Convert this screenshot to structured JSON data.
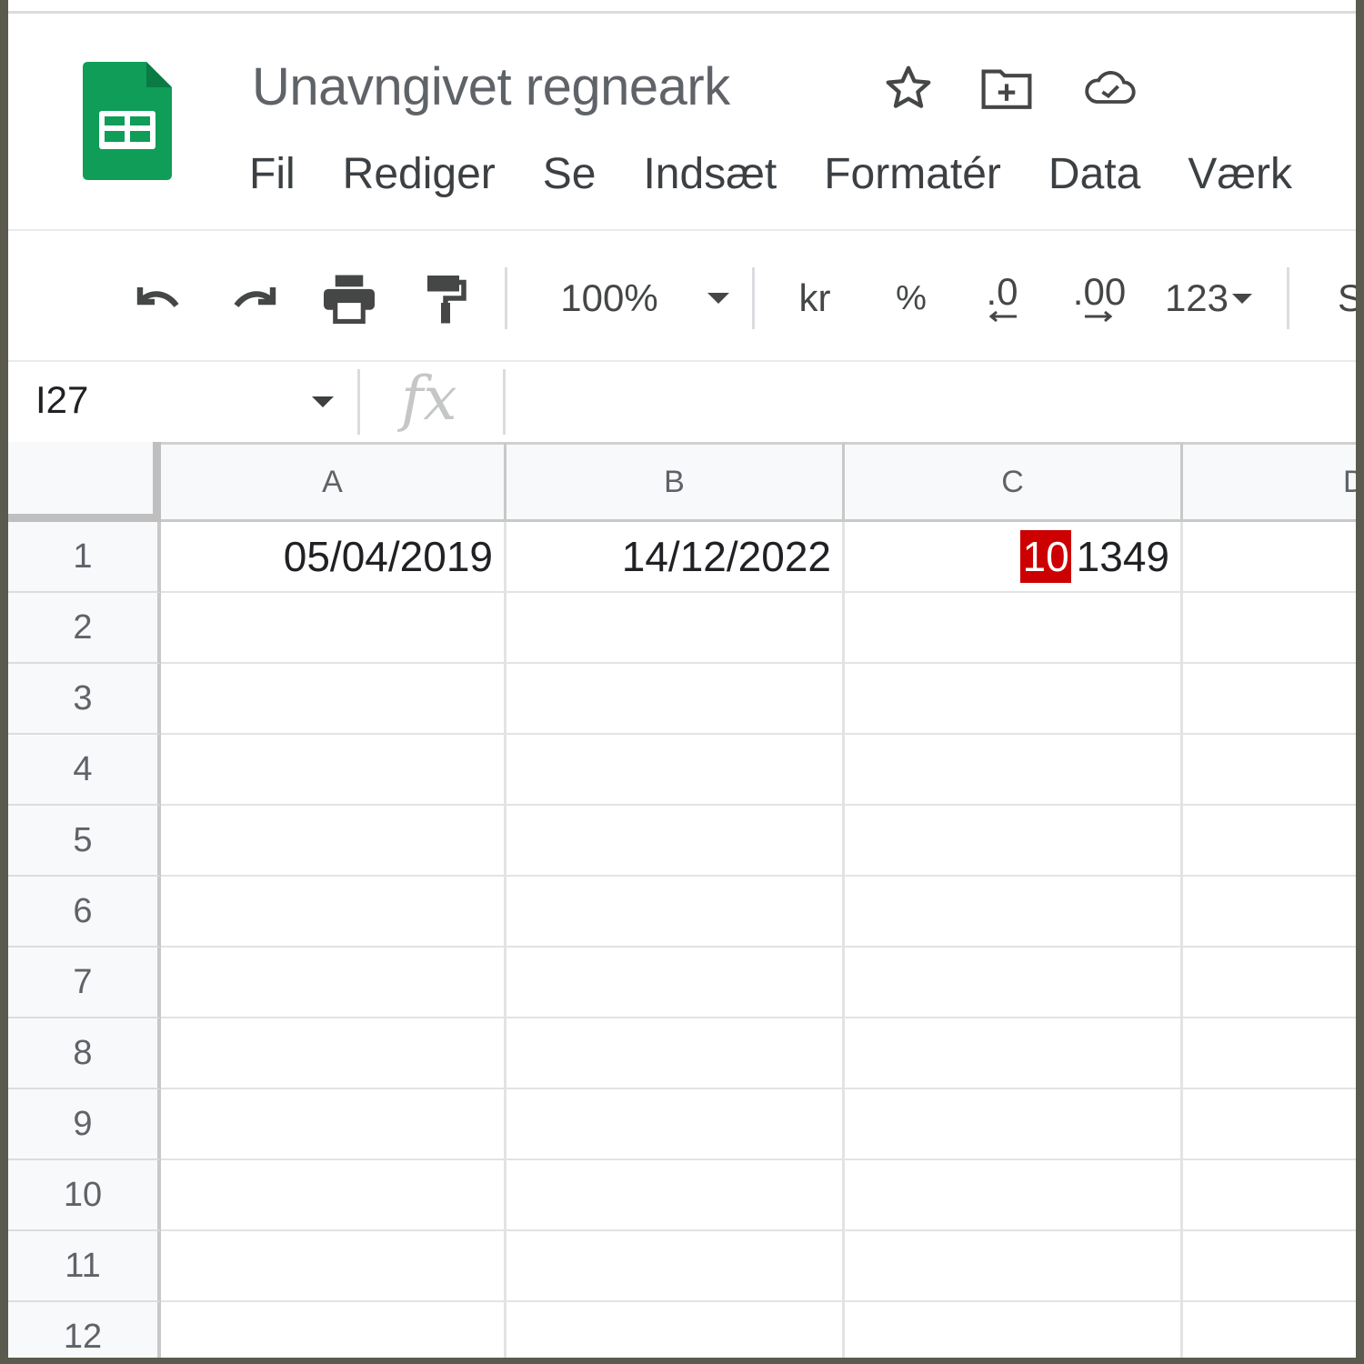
{
  "app": {
    "title": "Unavngivet regneark",
    "menu": [
      "Fil",
      "Rediger",
      "Se",
      "Indsæt",
      "Formatér",
      "Data",
      "Værk"
    ]
  },
  "header_icons": [
    "star-icon",
    "move-to-folder-icon",
    "cloud-status-icon"
  ],
  "toolbar": {
    "zoom": "100%",
    "currency": "kr",
    "percent": "%",
    "decrease_decimal": ".0",
    "increase_decimal": ".00",
    "more_formats": "123",
    "cut_off": "S"
  },
  "formula_bar": {
    "name_box": "I27",
    "fx_label": "fx",
    "value": ""
  },
  "sheet": {
    "columns": [
      "A",
      "B",
      "C",
      "D"
    ],
    "rows": [
      "1",
      "2",
      "3",
      "4",
      "5",
      "6",
      "7",
      "8",
      "9",
      "10",
      "11",
      "12"
    ],
    "cells": {
      "A1": "05/04/2019",
      "B1": "14/12/2022",
      "C1_highlight": "10",
      "C1_rest": "1349"
    },
    "highlight_color": "#cc0000"
  },
  "colors": {
    "logo_green": "#0f9d58",
    "grid_line": "#e2e3e3"
  }
}
